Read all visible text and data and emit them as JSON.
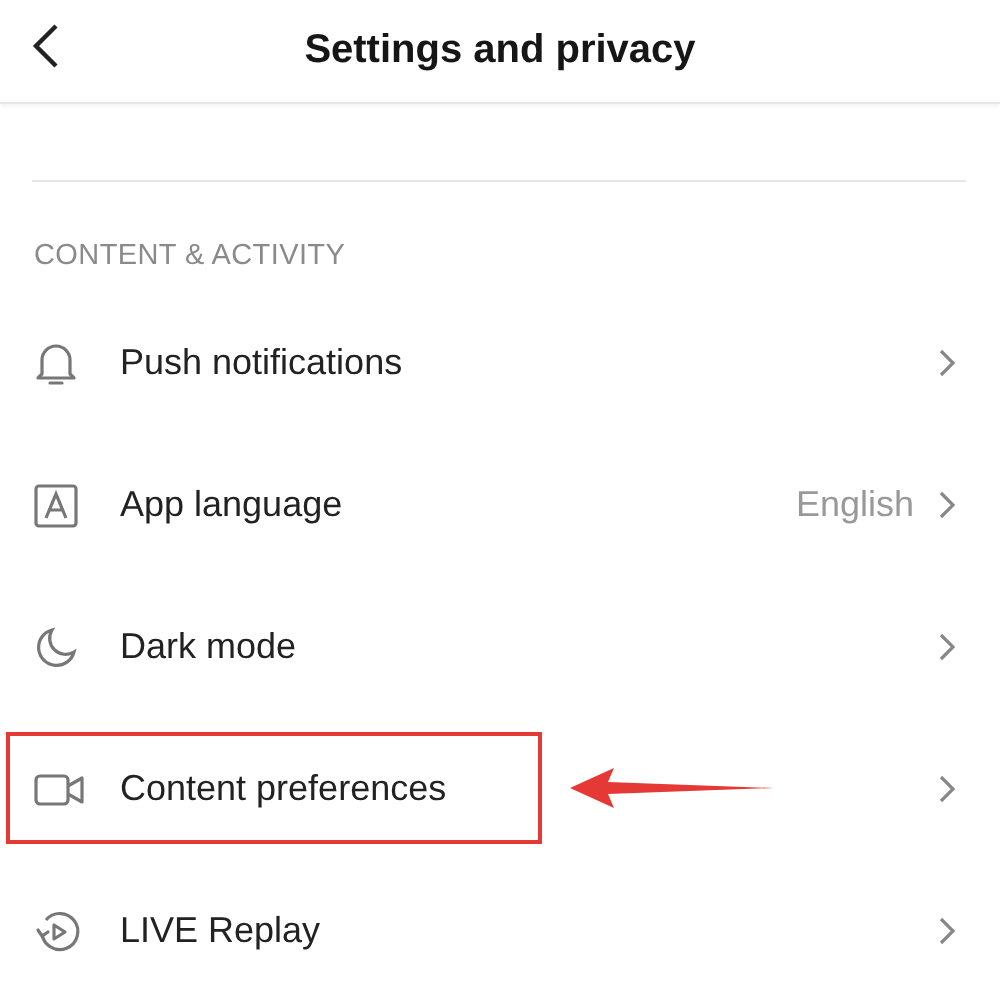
{
  "header": {
    "title": "Settings and privacy"
  },
  "section": {
    "title": "CONTENT & ACTIVITY",
    "items": [
      {
        "kind": "bell",
        "label": "Push notifications",
        "highlighted": false
      },
      {
        "kind": "language",
        "label": "App language",
        "value": "English",
        "highlighted": false
      },
      {
        "kind": "moon",
        "label": "Dark mode",
        "highlighted": false
      },
      {
        "kind": "camera",
        "label": "Content preferences",
        "highlighted": true
      },
      {
        "kind": "replay",
        "label": "LIVE Replay",
        "highlighted": false
      }
    ]
  }
}
